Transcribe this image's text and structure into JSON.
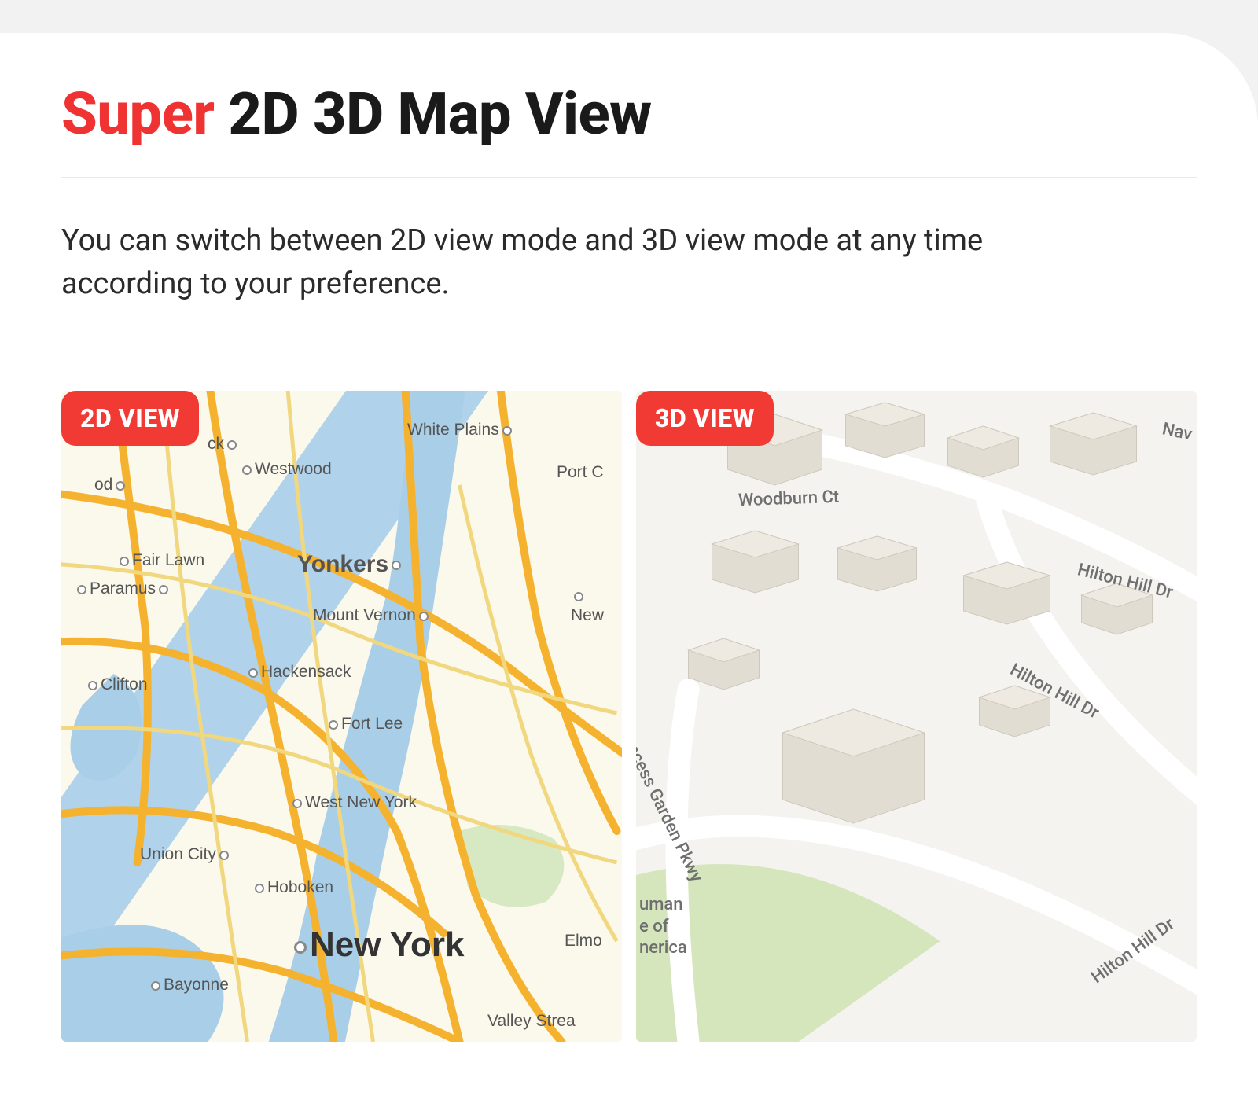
{
  "title": {
    "accent": "Super",
    "rest": " 2D 3D Map View"
  },
  "description": "You can switch between 2D view mode and 3D view mode at any time according to your preference.",
  "views": {
    "left_badge": "2D VIEW",
    "right_badge": "3D VIEW"
  },
  "map2d_cities": {
    "ck": "ck",
    "od": "od",
    "westwood": "Westwood",
    "white_plains": "White Plains",
    "port_c": "Port C",
    "fair_lawn": "Fair Lawn",
    "paramus": "Paramus",
    "yonkers": "Yonkers",
    "mount_vernon": "Mount Vernon",
    "new": "New",
    "clifton": "Clifton",
    "hackensack": "Hackensack",
    "fort_lee": "Fort Lee",
    "west_new_york": "West New York",
    "union_city": "Union City",
    "hoboken": "Hoboken",
    "new_york": "New York",
    "elmo": "Elmo",
    "bayonne": "Bayonne",
    "valley_strea": "Valley Strea"
  },
  "map3d_streets": {
    "woodburn_ct": "Woodburn Ct",
    "hilton_hill_dr_1": "Hilton Hill Dr",
    "hilton_hill_dr_2": "Hilton Hill Dr",
    "hilton_hill_dr_3": "Hilton Hill Dr",
    "princess_garden": "ncess Garden Pkwy",
    "nav": "Nav",
    "america_1": "uman",
    "america_2": "e of",
    "america_3": "nerica"
  }
}
